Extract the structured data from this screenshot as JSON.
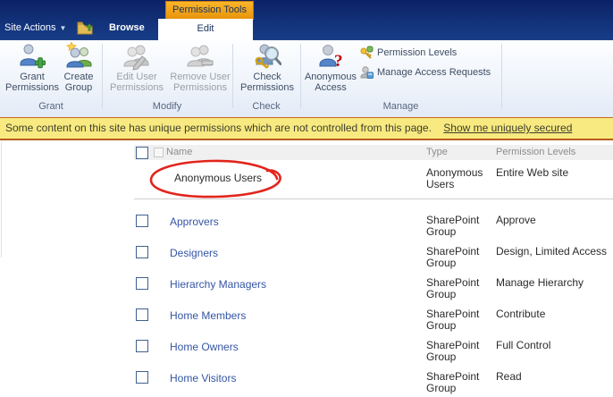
{
  "topbar": {
    "site_actions": "Site Actions",
    "browse_tab": "Browse",
    "contextual_group": "Permission Tools",
    "edit_tab": "Edit"
  },
  "ribbon": {
    "buttons": {
      "grant_permissions": "Grant Permissions",
      "create_group": "Create Group",
      "edit_user_permissions": "Edit User Permissions",
      "remove_user_permissions": "Remove User Permissions",
      "check_permissions": "Check Permissions",
      "anonymous_access": "Anonymous Access",
      "permission_levels": "Permission Levels",
      "manage_access_requests": "Manage Access Requests"
    },
    "groups": [
      {
        "label": "Grant"
      },
      {
        "label": "Modify"
      },
      {
        "label": "Check"
      },
      {
        "label": "Manage"
      }
    ]
  },
  "notice": {
    "message": "Some content on this site has unique permissions which are not controlled from this page.",
    "link": "Show me uniquely secured"
  },
  "table": {
    "headers": {
      "name": "Name",
      "type": "Type",
      "permissions": "Permission Levels"
    },
    "rows": [
      {
        "name": "Anonymous Users",
        "type": "Anonymous Users",
        "permissions": "Entire Web site"
      },
      {
        "name": "Approvers",
        "type": "SharePoint Group",
        "permissions": "Approve"
      },
      {
        "name": "Designers",
        "type": "SharePoint Group",
        "permissions": "Design, Limited Access"
      },
      {
        "name": "Hierarchy Managers",
        "type": "SharePoint Group",
        "permissions": "Manage Hierarchy"
      },
      {
        "name": "Home Members",
        "type": "SharePoint Group",
        "permissions": "Contribute"
      },
      {
        "name": "Home Owners",
        "type": "SharePoint Group",
        "permissions": "Full Control"
      },
      {
        "name": "Home Visitors",
        "type": "SharePoint Group",
        "permissions": "Read"
      }
    ]
  },
  "colors": {
    "topbar_navy": "#123179",
    "contextual_orange": "#E8940C",
    "notice_yellow": "#F8EA80",
    "link_blue": "#3455A4",
    "annotation_red": "#E2251C"
  }
}
